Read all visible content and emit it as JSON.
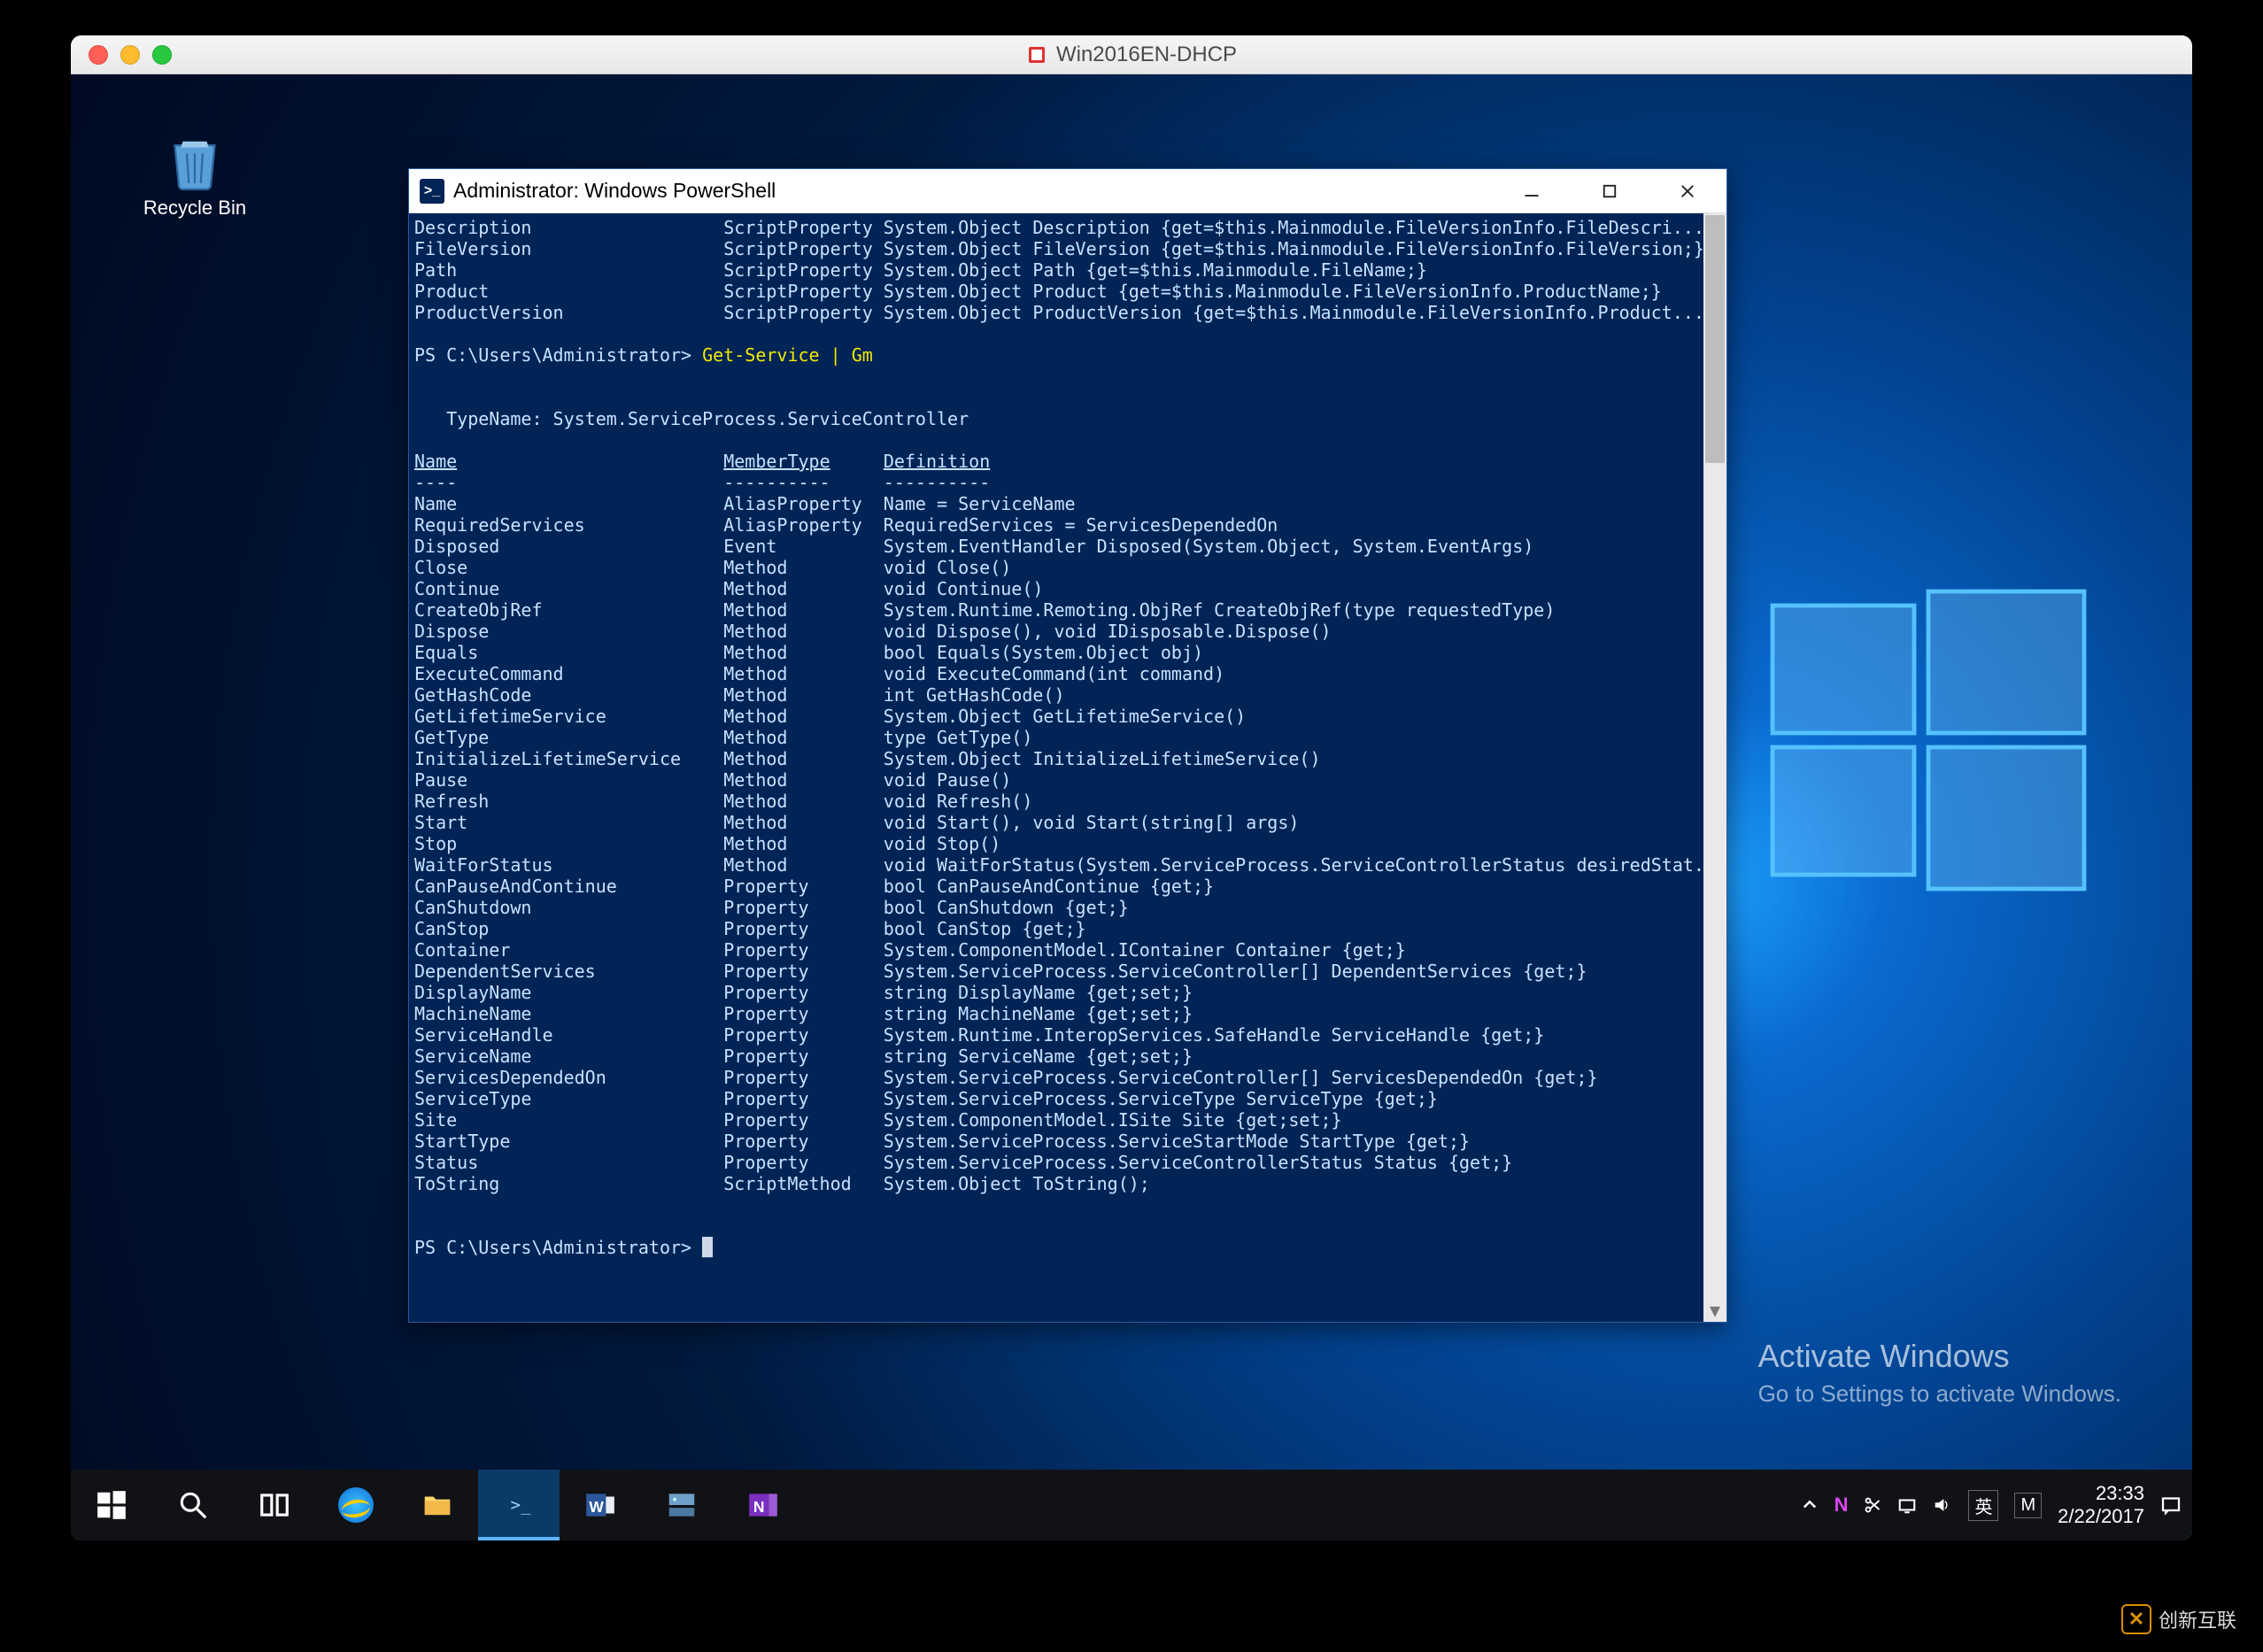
{
  "mac": {
    "title": "Win2016EN-DHCP"
  },
  "desktop": {
    "recycle_bin": "Recycle Bin",
    "activate_title": "Activate Windows",
    "activate_sub": "Go to Settings to activate Windows."
  },
  "taskbar": {
    "time": "23:33",
    "date": "2/22/2017",
    "lang": "英",
    "brand": "M"
  },
  "ps": {
    "title": "Administrator: Windows PowerShell",
    "prompt1": "PS C:\\Users\\Administrator>",
    "cmd1": " Get-Service | Gm",
    "typename": "   TypeName: System.ServiceProcess.ServiceController",
    "hdr_name": "Name",
    "hdr_type": "MemberType",
    "hdr_def": "Definition",
    "top_rows": [
      {
        "n": "Description",
        "t": "ScriptProperty",
        "d": "System.Object Description {get=$this.Mainmodule.FileVersionInfo.FileDescri..."
      },
      {
        "n": "FileVersion",
        "t": "ScriptProperty",
        "d": "System.Object FileVersion {get=$this.Mainmodule.FileVersionInfo.FileVersion;}"
      },
      {
        "n": "Path",
        "t": "ScriptProperty",
        "d": "System.Object Path {get=$this.Mainmodule.FileName;}"
      },
      {
        "n": "Product",
        "t": "ScriptProperty",
        "d": "System.Object Product {get=$this.Mainmodule.FileVersionInfo.ProductName;}"
      },
      {
        "n": "ProductVersion",
        "t": "ScriptProperty",
        "d": "System.Object ProductVersion {get=$this.Mainmodule.FileVersionInfo.Product..."
      }
    ],
    "rows": [
      {
        "n": "Name",
        "t": "AliasProperty",
        "d": "Name = ServiceName"
      },
      {
        "n": "RequiredServices",
        "t": "AliasProperty",
        "d": "RequiredServices = ServicesDependedOn"
      },
      {
        "n": "Disposed",
        "t": "Event",
        "d": "System.EventHandler Disposed(System.Object, System.EventArgs)"
      },
      {
        "n": "Close",
        "t": "Method",
        "d": "void Close()"
      },
      {
        "n": "Continue",
        "t": "Method",
        "d": "void Continue()"
      },
      {
        "n": "CreateObjRef",
        "t": "Method",
        "d": "System.Runtime.Remoting.ObjRef CreateObjRef(type requestedType)"
      },
      {
        "n": "Dispose",
        "t": "Method",
        "d": "void Dispose(), void IDisposable.Dispose()"
      },
      {
        "n": "Equals",
        "t": "Method",
        "d": "bool Equals(System.Object obj)"
      },
      {
        "n": "ExecuteCommand",
        "t": "Method",
        "d": "void ExecuteCommand(int command)"
      },
      {
        "n": "GetHashCode",
        "t": "Method",
        "d": "int GetHashCode()"
      },
      {
        "n": "GetLifetimeService",
        "t": "Method",
        "d": "System.Object GetLifetimeService()"
      },
      {
        "n": "GetType",
        "t": "Method",
        "d": "type GetType()"
      },
      {
        "n": "InitializeLifetimeService",
        "t": "Method",
        "d": "System.Object InitializeLifetimeService()"
      },
      {
        "n": "Pause",
        "t": "Method",
        "d": "void Pause()"
      },
      {
        "n": "Refresh",
        "t": "Method",
        "d": "void Refresh()"
      },
      {
        "n": "Start",
        "t": "Method",
        "d": "void Start(), void Start(string[] args)"
      },
      {
        "n": "Stop",
        "t": "Method",
        "d": "void Stop()"
      },
      {
        "n": "WaitForStatus",
        "t": "Method",
        "d": "void WaitForStatus(System.ServiceProcess.ServiceControllerStatus desiredStat..."
      },
      {
        "n": "CanPauseAndContinue",
        "t": "Property",
        "d": "bool CanPauseAndContinue {get;}"
      },
      {
        "n": "CanShutdown",
        "t": "Property",
        "d": "bool CanShutdown {get;}"
      },
      {
        "n": "CanStop",
        "t": "Property",
        "d": "bool CanStop {get;}"
      },
      {
        "n": "Container",
        "t": "Property",
        "d": "System.ComponentModel.IContainer Container {get;}"
      },
      {
        "n": "DependentServices",
        "t": "Property",
        "d": "System.ServiceProcess.ServiceController[] DependentServices {get;}"
      },
      {
        "n": "DisplayName",
        "t": "Property",
        "d": "string DisplayName {get;set;}"
      },
      {
        "n": "MachineName",
        "t": "Property",
        "d": "string MachineName {get;set;}"
      },
      {
        "n": "ServiceHandle",
        "t": "Property",
        "d": "System.Runtime.InteropServices.SafeHandle ServiceHandle {get;}"
      },
      {
        "n": "ServiceName",
        "t": "Property",
        "d": "string ServiceName {get;set;}"
      },
      {
        "n": "ServicesDependedOn",
        "t": "Property",
        "d": "System.ServiceProcess.ServiceController[] ServicesDependedOn {get;}"
      },
      {
        "n": "ServiceType",
        "t": "Property",
        "d": "System.ServiceProcess.ServiceType ServiceType {get;}"
      },
      {
        "n": "Site",
        "t": "Property",
        "d": "System.ComponentModel.ISite Site {get;set;}"
      },
      {
        "n": "StartType",
        "t": "Property",
        "d": "System.ServiceProcess.ServiceStartMode StartType {get;}"
      },
      {
        "n": "Status",
        "t": "Property",
        "d": "System.ServiceProcess.ServiceControllerStatus Status {get;}"
      },
      {
        "n": "ToString",
        "t": "ScriptMethod",
        "d": "System.Object ToString();"
      }
    ],
    "prompt2": "PS C:\\Users\\Administrator> "
  },
  "watermark": "创新互联"
}
